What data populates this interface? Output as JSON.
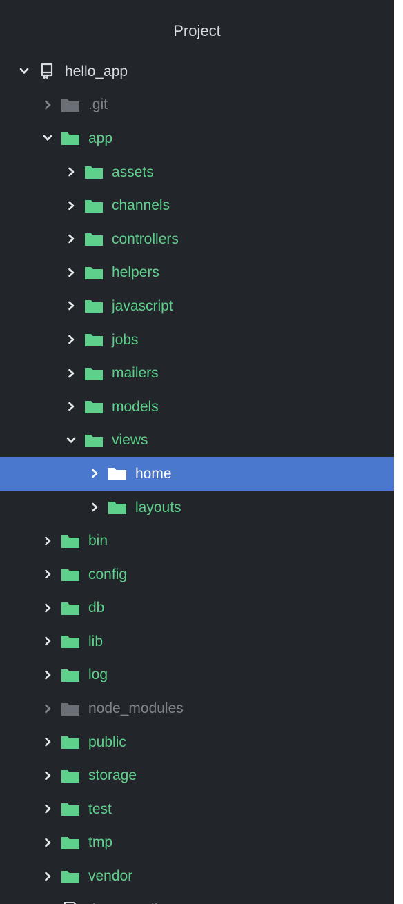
{
  "panel": {
    "title": "Project"
  },
  "colors": {
    "background": "#22262b",
    "folder": "#5fd08c",
    "ignored": "#7f848c",
    "selection": "#4b78cf",
    "root_text": "#d7dae0"
  },
  "tree": [
    {
      "label": "hello_app",
      "depth": 0,
      "expanded": true,
      "icon": "repo-icon",
      "state": "root"
    },
    {
      "label": ".git",
      "depth": 1,
      "expanded": false,
      "icon": "folder-icon",
      "state": "dim"
    },
    {
      "label": "app",
      "depth": 1,
      "expanded": true,
      "icon": "folder-icon",
      "state": "normal"
    },
    {
      "label": "assets",
      "depth": 2,
      "expanded": false,
      "icon": "folder-icon",
      "state": "normal"
    },
    {
      "label": "channels",
      "depth": 2,
      "expanded": false,
      "icon": "folder-icon",
      "state": "normal"
    },
    {
      "label": "controllers",
      "depth": 2,
      "expanded": false,
      "icon": "folder-icon",
      "state": "normal"
    },
    {
      "label": "helpers",
      "depth": 2,
      "expanded": false,
      "icon": "folder-icon",
      "state": "normal"
    },
    {
      "label": "javascript",
      "depth": 2,
      "expanded": false,
      "icon": "folder-icon",
      "state": "normal"
    },
    {
      "label": "jobs",
      "depth": 2,
      "expanded": false,
      "icon": "folder-icon",
      "state": "normal"
    },
    {
      "label": "mailers",
      "depth": 2,
      "expanded": false,
      "icon": "folder-icon",
      "state": "normal"
    },
    {
      "label": "models",
      "depth": 2,
      "expanded": false,
      "icon": "folder-icon",
      "state": "normal"
    },
    {
      "label": "views",
      "depth": 2,
      "expanded": true,
      "icon": "folder-icon",
      "state": "normal"
    },
    {
      "label": "home",
      "depth": 3,
      "expanded": false,
      "icon": "folder-icon",
      "state": "selected"
    },
    {
      "label": "layouts",
      "depth": 3,
      "expanded": false,
      "icon": "folder-icon",
      "state": "normal"
    },
    {
      "label": "bin",
      "depth": 1,
      "expanded": false,
      "icon": "folder-icon",
      "state": "normal"
    },
    {
      "label": "config",
      "depth": 1,
      "expanded": false,
      "icon": "folder-icon",
      "state": "normal"
    },
    {
      "label": "db",
      "depth": 1,
      "expanded": false,
      "icon": "folder-icon",
      "state": "normal"
    },
    {
      "label": "lib",
      "depth": 1,
      "expanded": false,
      "icon": "folder-icon",
      "state": "normal"
    },
    {
      "label": "log",
      "depth": 1,
      "expanded": false,
      "icon": "folder-icon",
      "state": "normal"
    },
    {
      "label": "node_modules",
      "depth": 1,
      "expanded": false,
      "icon": "folder-icon",
      "state": "dim"
    },
    {
      "label": "public",
      "depth": 1,
      "expanded": false,
      "icon": "folder-icon",
      "state": "normal"
    },
    {
      "label": "storage",
      "depth": 1,
      "expanded": false,
      "icon": "folder-icon",
      "state": "normal"
    },
    {
      "label": "test",
      "depth": 1,
      "expanded": false,
      "icon": "folder-icon",
      "state": "normal"
    },
    {
      "label": "tmp",
      "depth": 1,
      "expanded": false,
      "icon": "folder-icon",
      "state": "normal"
    },
    {
      "label": "vendor",
      "depth": 1,
      "expanded": false,
      "icon": "folder-icon",
      "state": "normal"
    },
    {
      "label": ".browserslistrc",
      "depth": 1,
      "expanded": null,
      "icon": "file-icon",
      "state": "root"
    }
  ]
}
